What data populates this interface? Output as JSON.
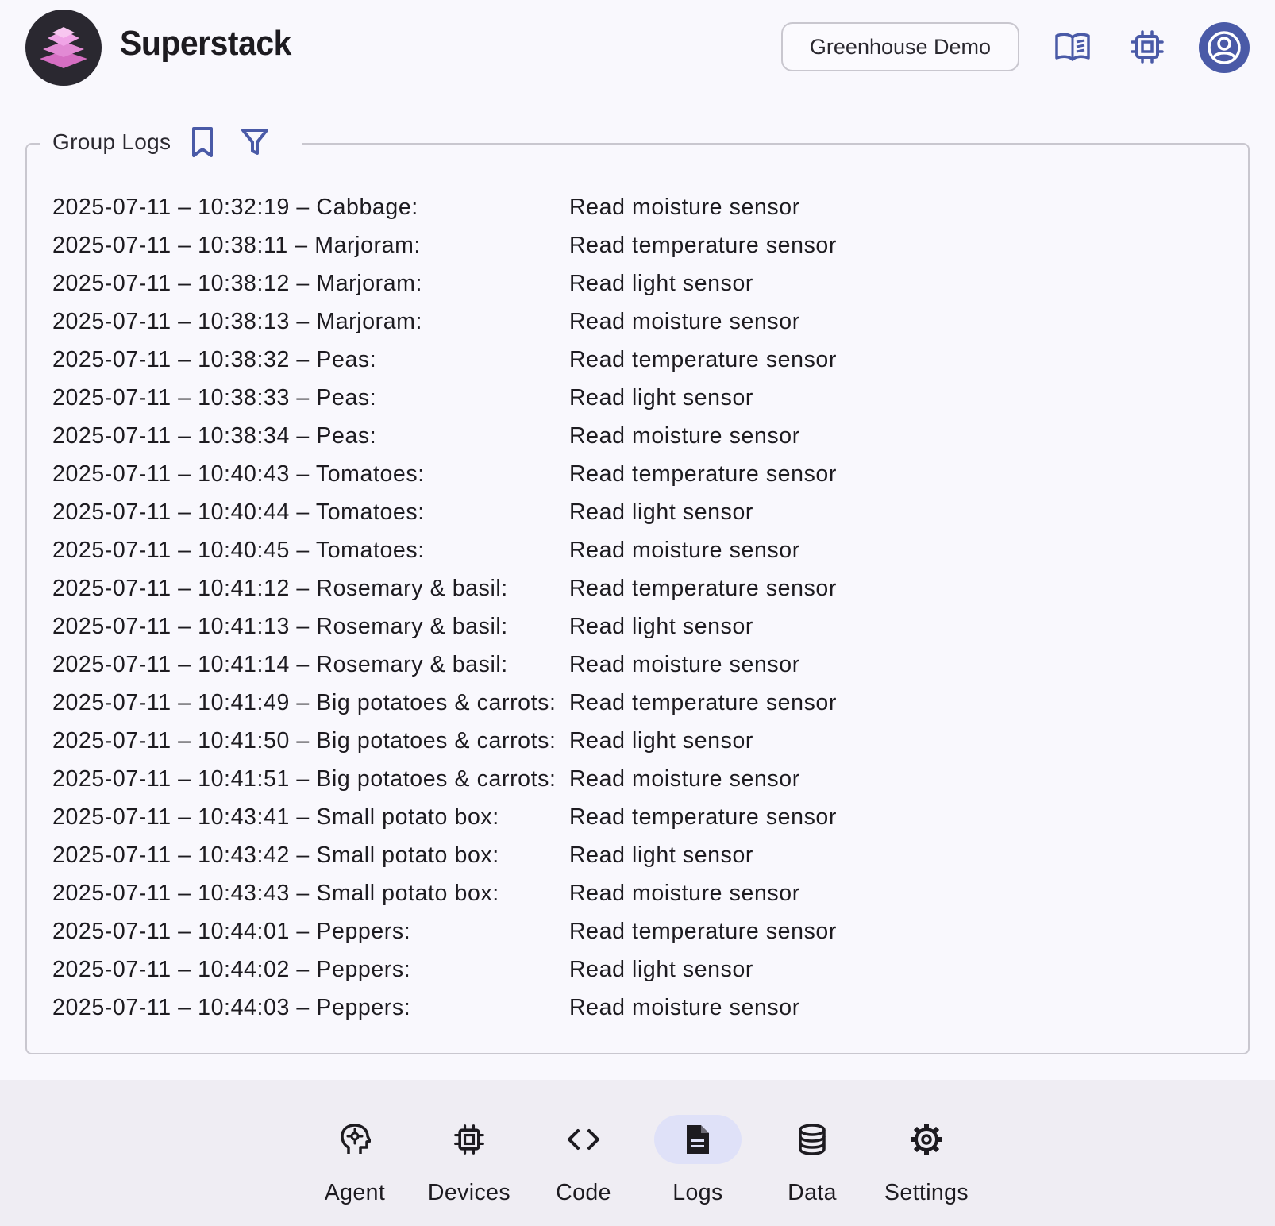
{
  "app": {
    "brand": "Superstack",
    "project": "Greenhouse Demo",
    "icons": {
      "docs": "book-open-icon",
      "device": "chip-icon",
      "account": "account-circle-icon"
    },
    "colors": {
      "accent": "#4a5aa7",
      "logo_bg": "#2a2830",
      "logo_layers": "#e07fd0",
      "nav_active": "#dfe1f8"
    }
  },
  "logs": {
    "title": "Group Logs",
    "icons": {
      "bookmark": "bookmark-icon",
      "filter": "filter-icon"
    },
    "rows": [
      {
        "meta": "2025-07-11 – 10:32:19 – Cabbage:",
        "message": "Read moisture sensor"
      },
      {
        "meta": "2025-07-11 – 10:38:11 – Marjoram:",
        "message": "Read temperature sensor"
      },
      {
        "meta": "2025-07-11 – 10:38:12 – Marjoram:",
        "message": "Read light sensor"
      },
      {
        "meta": "2025-07-11 – 10:38:13 – Marjoram:",
        "message": "Read moisture sensor"
      },
      {
        "meta": "2025-07-11 – 10:38:32 – Peas:",
        "message": "Read temperature sensor"
      },
      {
        "meta": "2025-07-11 – 10:38:33 – Peas:",
        "message": "Read light sensor"
      },
      {
        "meta": "2025-07-11 – 10:38:34 – Peas:",
        "message": "Read moisture sensor"
      },
      {
        "meta": "2025-07-11 – 10:40:43 – Tomatoes:",
        "message": "Read temperature sensor"
      },
      {
        "meta": "2025-07-11 – 10:40:44 – Tomatoes:",
        "message": "Read light sensor"
      },
      {
        "meta": "2025-07-11 – 10:40:45 – Tomatoes:",
        "message": "Read moisture sensor"
      },
      {
        "meta": "2025-07-11 – 10:41:12 – Rosemary & basil:",
        "message": "Read temperature sensor"
      },
      {
        "meta": "2025-07-11 – 10:41:13 – Rosemary & basil:",
        "message": "Read light sensor"
      },
      {
        "meta": "2025-07-11 – 10:41:14 – Rosemary & basil:",
        "message": "Read moisture sensor"
      },
      {
        "meta": "2025-07-11 – 10:41:49 – Big potatoes & carrots:",
        "message": "Read temperature sensor"
      },
      {
        "meta": "2025-07-11 – 10:41:50 – Big potatoes & carrots:",
        "message": "Read light sensor"
      },
      {
        "meta": "2025-07-11 – 10:41:51 – Big potatoes & carrots:",
        "message": "Read moisture sensor"
      },
      {
        "meta": "2025-07-11 – 10:43:41 – Small potato box:",
        "message": "Read temperature sensor"
      },
      {
        "meta": "2025-07-11 – 10:43:42 – Small potato box:",
        "message": "Read light sensor"
      },
      {
        "meta": "2025-07-11 – 10:43:43 – Small potato box:",
        "message": "Read moisture sensor"
      },
      {
        "meta": "2025-07-11 – 10:44:01 – Peppers:",
        "message": "Read temperature sensor"
      },
      {
        "meta": "2025-07-11 – 10:44:02 – Peppers:",
        "message": "Read light sensor"
      },
      {
        "meta": "2025-07-11 – 10:44:03 – Peppers:",
        "message": "Read moisture sensor"
      }
    ]
  },
  "nav": {
    "active": "Logs",
    "items": [
      {
        "label": "Agent",
        "icon": "psychology-head-gear-icon"
      },
      {
        "label": "Devices",
        "icon": "chip-icon"
      },
      {
        "label": "Code",
        "icon": "code-brackets-icon"
      },
      {
        "label": "Logs",
        "icon": "document-icon"
      },
      {
        "label": "Data",
        "icon": "database-icon"
      },
      {
        "label": "Settings",
        "icon": "gear-icon"
      }
    ]
  }
}
